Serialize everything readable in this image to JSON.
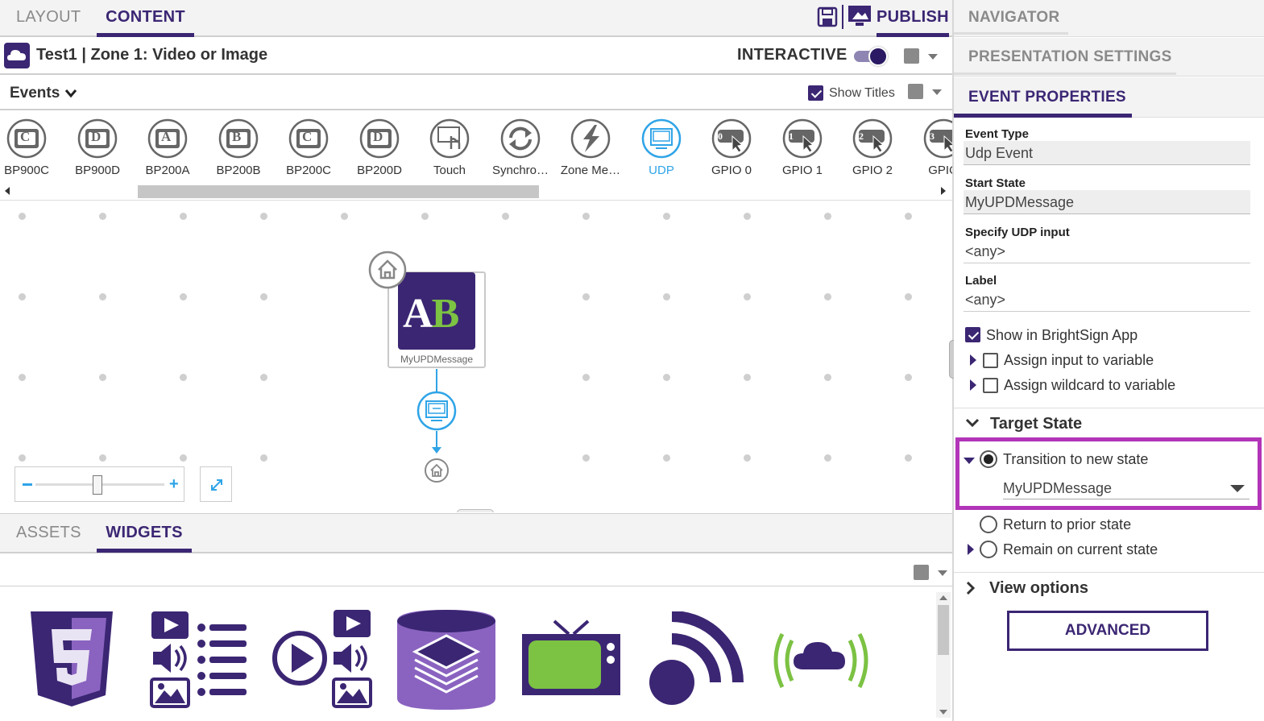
{
  "left_tabs": {
    "layout": "LAYOUT",
    "content": "CONTENT",
    "publish": "PUBLISH"
  },
  "zone": {
    "title": "Test1 | Zone 1: Video or Image",
    "interactive_label": "INTERACTIVE",
    "interactive_on": true
  },
  "events_bar": {
    "events_label": "Events",
    "show_titles_label": "Show Titles",
    "show_titles_checked": true
  },
  "palette": [
    {
      "label": "BP900C",
      "icon": "bp900c-icon",
      "glyph": "C"
    },
    {
      "label": "BP900D",
      "icon": "bp900d-icon",
      "glyph": "D"
    },
    {
      "label": "BP200A",
      "icon": "bp200a-icon",
      "glyph": "A"
    },
    {
      "label": "BP200B",
      "icon": "bp200b-icon",
      "glyph": "B"
    },
    {
      "label": "BP200C",
      "icon": "bp200c-icon",
      "glyph": "C"
    },
    {
      "label": "BP200D",
      "icon": "bp200d-icon",
      "glyph": "D"
    },
    {
      "label": "Touch",
      "icon": "touch-icon",
      "glyph": ""
    },
    {
      "label": "Synchro…",
      "icon": "synchronize-icon",
      "glyph": ""
    },
    {
      "label": "Zone Me…",
      "icon": "zone-message-icon",
      "glyph": ""
    },
    {
      "label": "UDP",
      "icon": "udp-icon",
      "glyph": "",
      "selected": true
    },
    {
      "label": "GPIO 0",
      "icon": "gpio0-icon",
      "glyph": "0"
    },
    {
      "label": "GPIO 1",
      "icon": "gpio1-icon",
      "glyph": "1"
    },
    {
      "label": "GPIO 2",
      "icon": "gpio2-icon",
      "glyph": "2"
    },
    {
      "label": "GPIO",
      "icon": "gpio3-icon",
      "glyph": "3"
    }
  ],
  "canvas": {
    "state_name": "MyUPDMessage",
    "state_logo": "AB"
  },
  "bottom_tabs": {
    "assets": "ASSETS",
    "widgets": "WIDGETS"
  },
  "right_tabs": {
    "navigator": "NAVIGATOR",
    "presentation_settings": "PRESENTATION SETTINGS",
    "event_properties": "EVENT PROPERTIES"
  },
  "event_properties": {
    "event_type_label": "Event Type",
    "event_type_value": "Udp Event",
    "start_state_label": "Start State",
    "start_state_value": "MyUPDMessage",
    "udp_input_label": "Specify UDP input",
    "udp_input_value": "<any>",
    "label_label": "Label",
    "label_value": "<any>",
    "show_in_app": "Show in BrightSign App",
    "assign_input": "Assign input to variable",
    "assign_wildcard": "Assign wildcard to variable",
    "target_state_title": "Target State",
    "transition_new": "Transition to new state",
    "transition_target": "MyUPDMessage",
    "return_prior": "Return to prior state",
    "remain_current": "Remain on current state",
    "view_options": "View options",
    "advanced_button": "ADVANCED"
  },
  "colors": {
    "brand": "#3b2673",
    "accent": "#2fa4e7",
    "highlight": "#b234b8",
    "green": "#7cc243"
  }
}
